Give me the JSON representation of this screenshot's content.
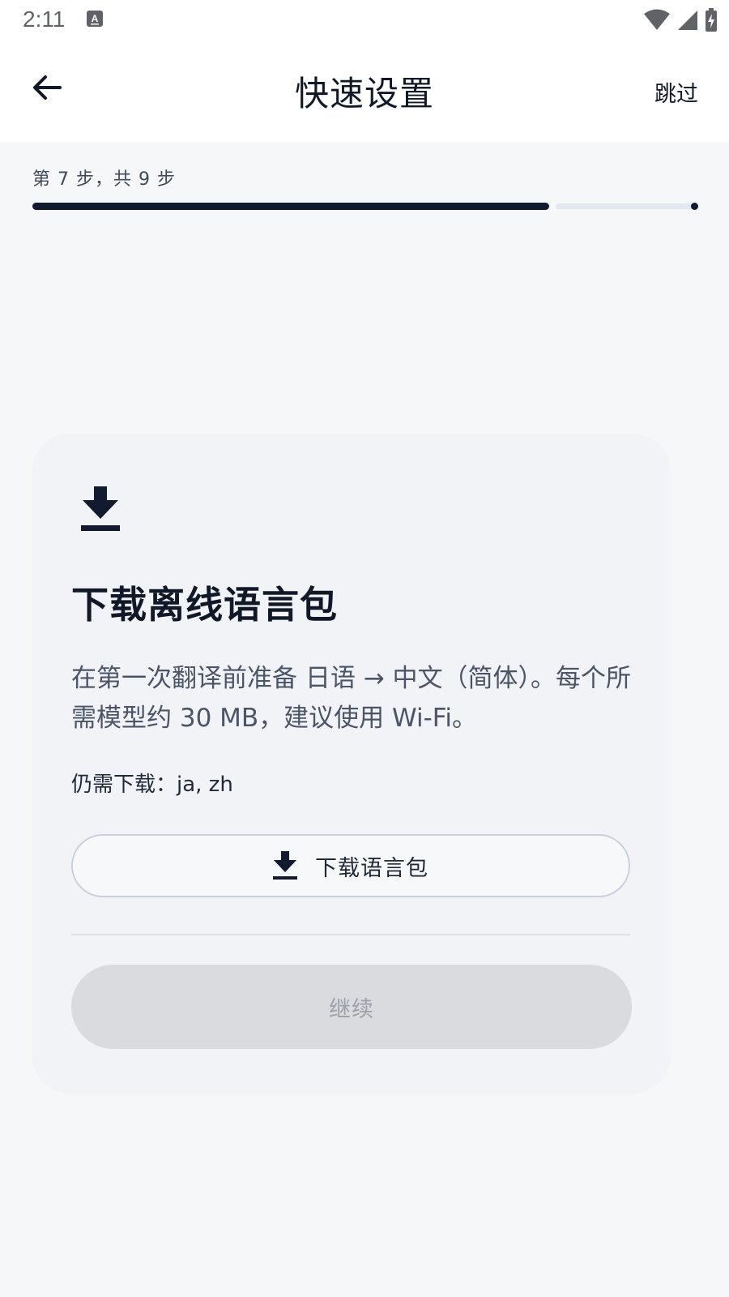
{
  "status_bar": {
    "time": "2:11",
    "icons": [
      "keyboard-a-icon",
      "wifi-icon",
      "signal-icon",
      "battery-charging-icon"
    ]
  },
  "app_bar": {
    "back_icon": "arrow-left-icon",
    "title": "快速设置",
    "skip_label": "跳过"
  },
  "progress": {
    "step_text": "第 7 步，共 9 步",
    "current_step": 7,
    "total_steps": 9,
    "fraction": 0.778
  },
  "card": {
    "icon": "download-icon",
    "title": "下载离线语言包",
    "description": "在第一次翻译前准备 日语 → 中文（简体）。每个所需模型约 30 MB，建议使用 Wi-Fi。",
    "remaining_text": "仍需下载：ja, zh",
    "download_button_label": "下载语言包",
    "continue_label": "继续"
  },
  "colors": {
    "accent": "#111a2e",
    "background": "#f6f7f9",
    "card": "#f1f3f6",
    "disabled_button": "#dadbde"
  }
}
